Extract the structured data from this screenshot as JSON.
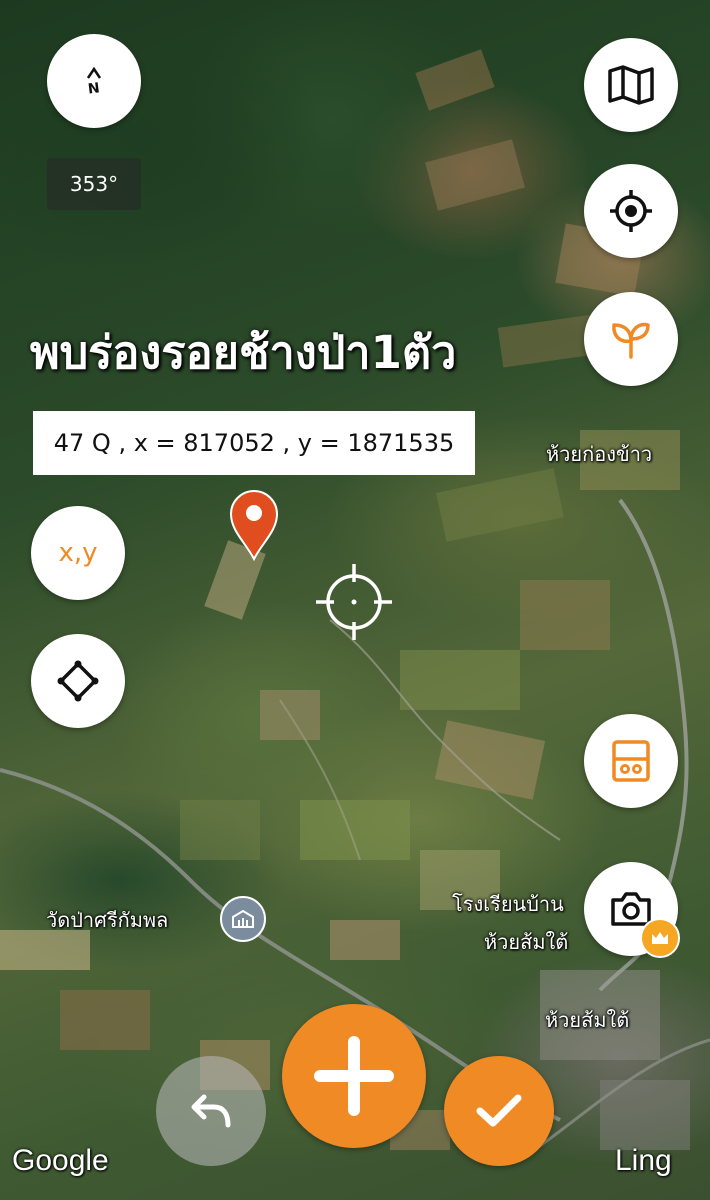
{
  "compass": {
    "north_label": "N",
    "heading": "353°"
  },
  "report": {
    "title": "พบร่องรอยช้างป่า1ตัว",
    "coordinates": "47 Q , x = 817052 , y = 1871535"
  },
  "left_tools": {
    "xy_label": "x,y"
  },
  "places": [
    {
      "name": "ห้วยก่องข้าว"
    },
    {
      "name": "วัดป่าศรีกัมพล"
    },
    {
      "name": "โรงเรียนบ้าน"
    },
    {
      "name": "ห้วยส้มใต้"
    },
    {
      "name": "ห้วยส้มใต้"
    }
  ],
  "attribution": {
    "google": "Google",
    "user": "Ling"
  },
  "colors": {
    "accent": "#f08a24",
    "marker": "#e04e1f",
    "white": "#ffffff"
  },
  "icons": [
    "compass-icon",
    "map-icon",
    "locate-icon",
    "sprout-icon",
    "xy-icon",
    "polygon-icon",
    "calculator-icon",
    "camera-icon",
    "crown-icon",
    "temple-icon",
    "undo-icon",
    "plus-icon",
    "check-icon",
    "crosshair-icon",
    "map-pin-icon"
  ]
}
